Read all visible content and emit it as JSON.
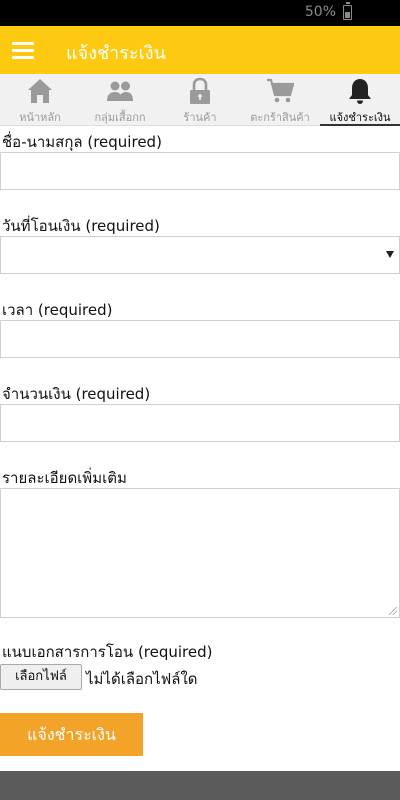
{
  "status_bar": {
    "battery": "50%"
  },
  "app_bar": {
    "title": "แจ้งชำระเงิน"
  },
  "tabs": [
    {
      "label": "หน้าหลัก",
      "icon": "home-icon",
      "active": false
    },
    {
      "label": "กลุ่มเสื้อกก",
      "icon": "users-icon",
      "active": false
    },
    {
      "label": "ร้านค้า",
      "icon": "lock-icon",
      "active": false
    },
    {
      "label": "ตะกร้าสินค้า",
      "icon": "cart-icon",
      "active": false
    },
    {
      "label": "แจ้งชำระเงิน",
      "icon": "bell-icon",
      "active": true
    }
  ],
  "form": {
    "name_label": "ชื่อ-นามสกุล (required)",
    "name_value": "",
    "date_label": "วันที่โอนเงิน (required)",
    "date_value": "",
    "time_label": "เวลา (required)",
    "time_value": "",
    "amount_label": "จำนวนเงิน (required)",
    "amount_value": "",
    "details_label": "รายละเอียดเพิ่มเติม",
    "details_value": "",
    "attachment_label": "แนบเอกสารการโอน (required)",
    "choose_file_label": "เลือกไฟล์",
    "no_file_text": "ไม่ได้เลือกไฟล์ใด",
    "submit_label": "แจ้งชำระเงิน"
  },
  "colors": {
    "app_bar": "#fdc911",
    "submit_button": "#f4a329",
    "footer": "#5b5b5b"
  }
}
